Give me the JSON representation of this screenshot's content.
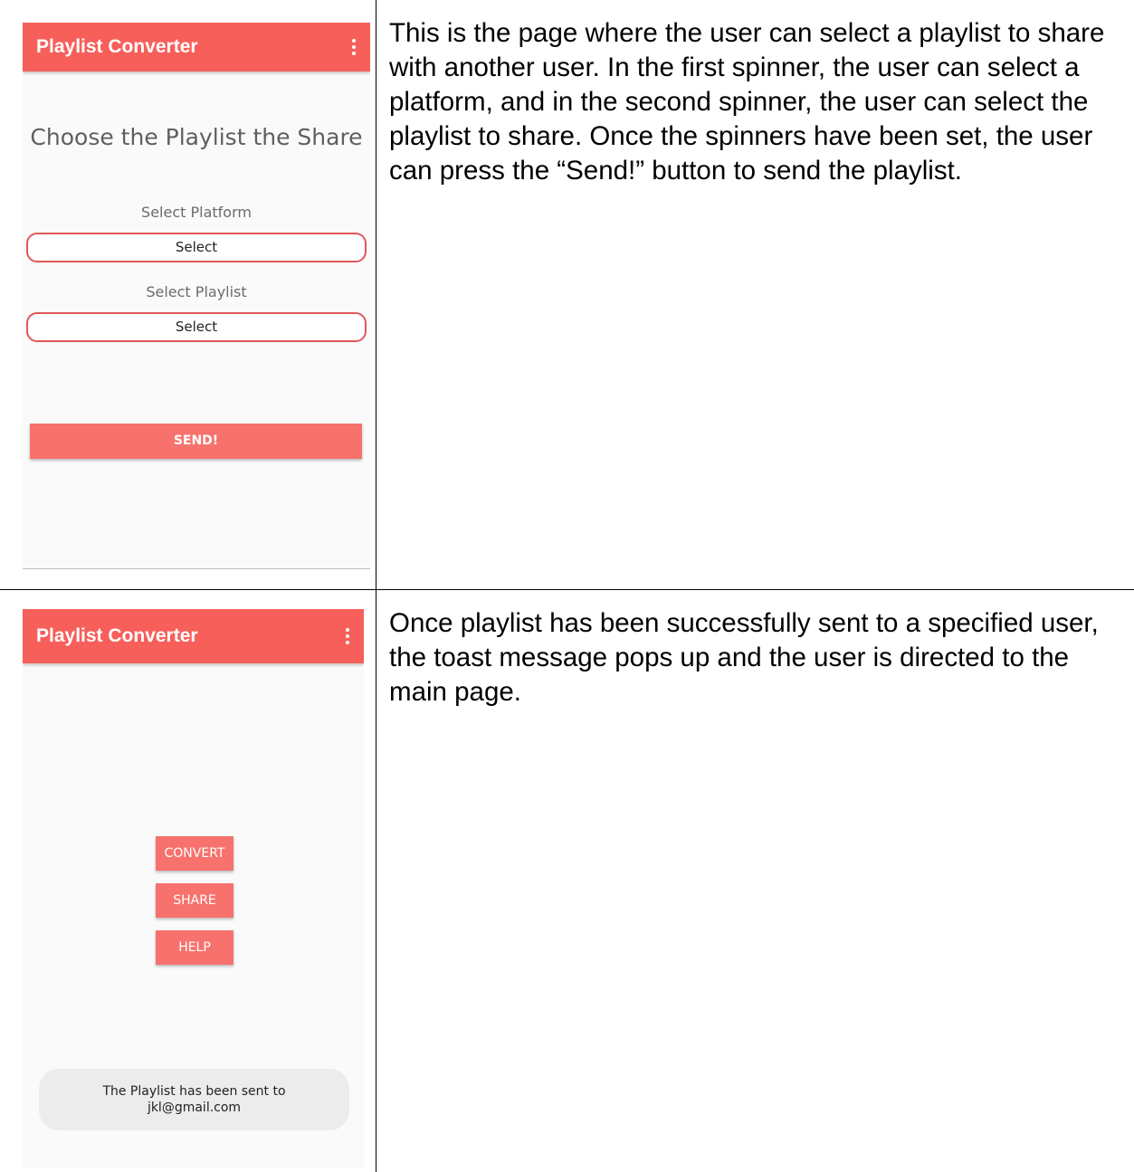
{
  "screen1": {
    "app_title": "Playlist Converter",
    "heading": "Choose the Playlist the Share",
    "platform_label": "Select Platform",
    "platform_value": "Select",
    "playlist_label": "Select Playlist",
    "playlist_value": "Select",
    "send_label": "SEND!",
    "description": "This is the page where the user can select a playlist to share with another user. In the first spinner, the user can select a platform, and in the second spinner, the user can select the playlist to share. Once the spinners have been set, the user can press the “Send!” button to send the playlist."
  },
  "screen2": {
    "app_title": "Playlist Converter",
    "menu": [
      "CONVERT",
      "SHARE",
      "HELP"
    ],
    "toast_line1": "The Playlist has been sent to",
    "toast_line2": "jkl@gmail.com",
    "description": "Once playlist has been successfully sent to a specified user, the toast message pops up and the user is directed to the main page."
  },
  "colors": {
    "app_bar": "#f75f5a",
    "button": "#f7726d",
    "spinner_border": "#e0575a"
  },
  "icons": {
    "overflow_menu": "kebab-menu-icon"
  }
}
